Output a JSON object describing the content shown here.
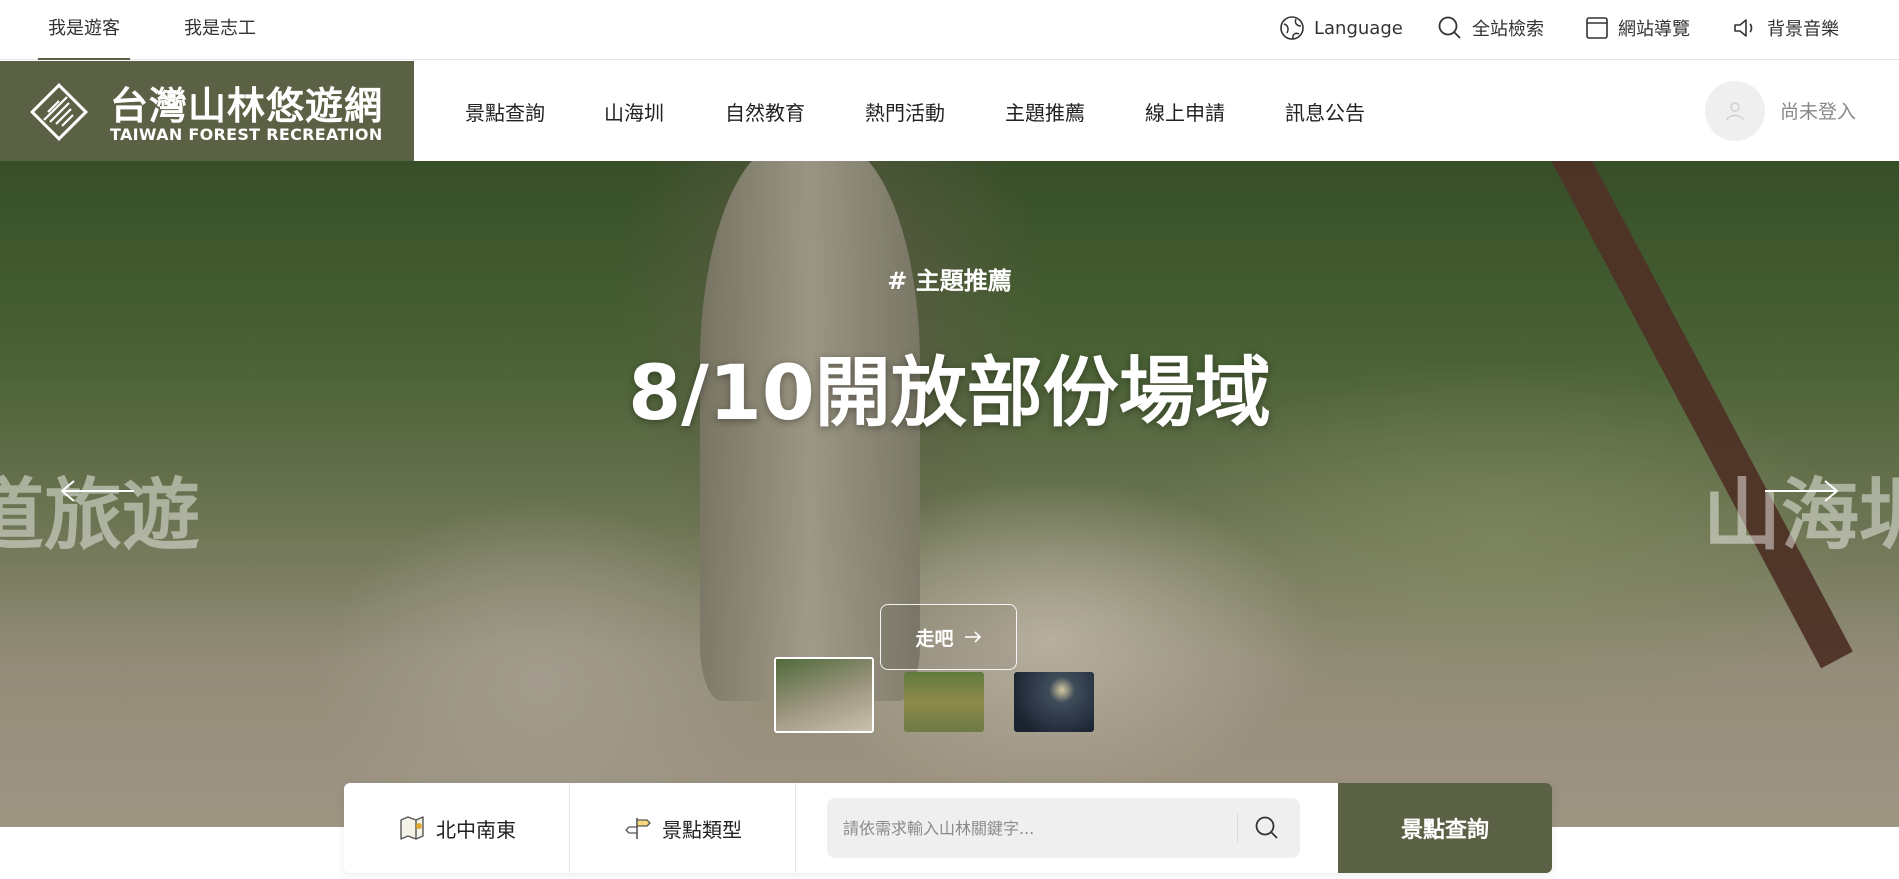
{
  "roles": {
    "visitor": "我是遊客",
    "volunteer": "我是志工"
  },
  "utility": {
    "language": "Language",
    "site_search": "全站檢索",
    "sitemap": "網站導覽",
    "music": "背景音樂"
  },
  "brand": {
    "name_cn": "台灣山林悠遊網",
    "name_en": "TAIWAN FOREST RECREATION",
    "color": "#5b6144"
  },
  "nav": {
    "items": [
      "景點查詢",
      "山海圳",
      "自然教育",
      "熱門活動",
      "主題推薦",
      "線上申請",
      "訊息公告"
    ]
  },
  "user": {
    "status": "尚未登入"
  },
  "hero": {
    "tag": "# 主題推薦",
    "title": "8/10開放部份場域",
    "prev_slide": "道旅遊",
    "next_slide": "山海圳",
    "cta": "走吧"
  },
  "search": {
    "region": "北中南東",
    "category": "景點類型",
    "placeholder": "請依需求輸入山林關鍵字...",
    "submit": "景點查詢"
  }
}
